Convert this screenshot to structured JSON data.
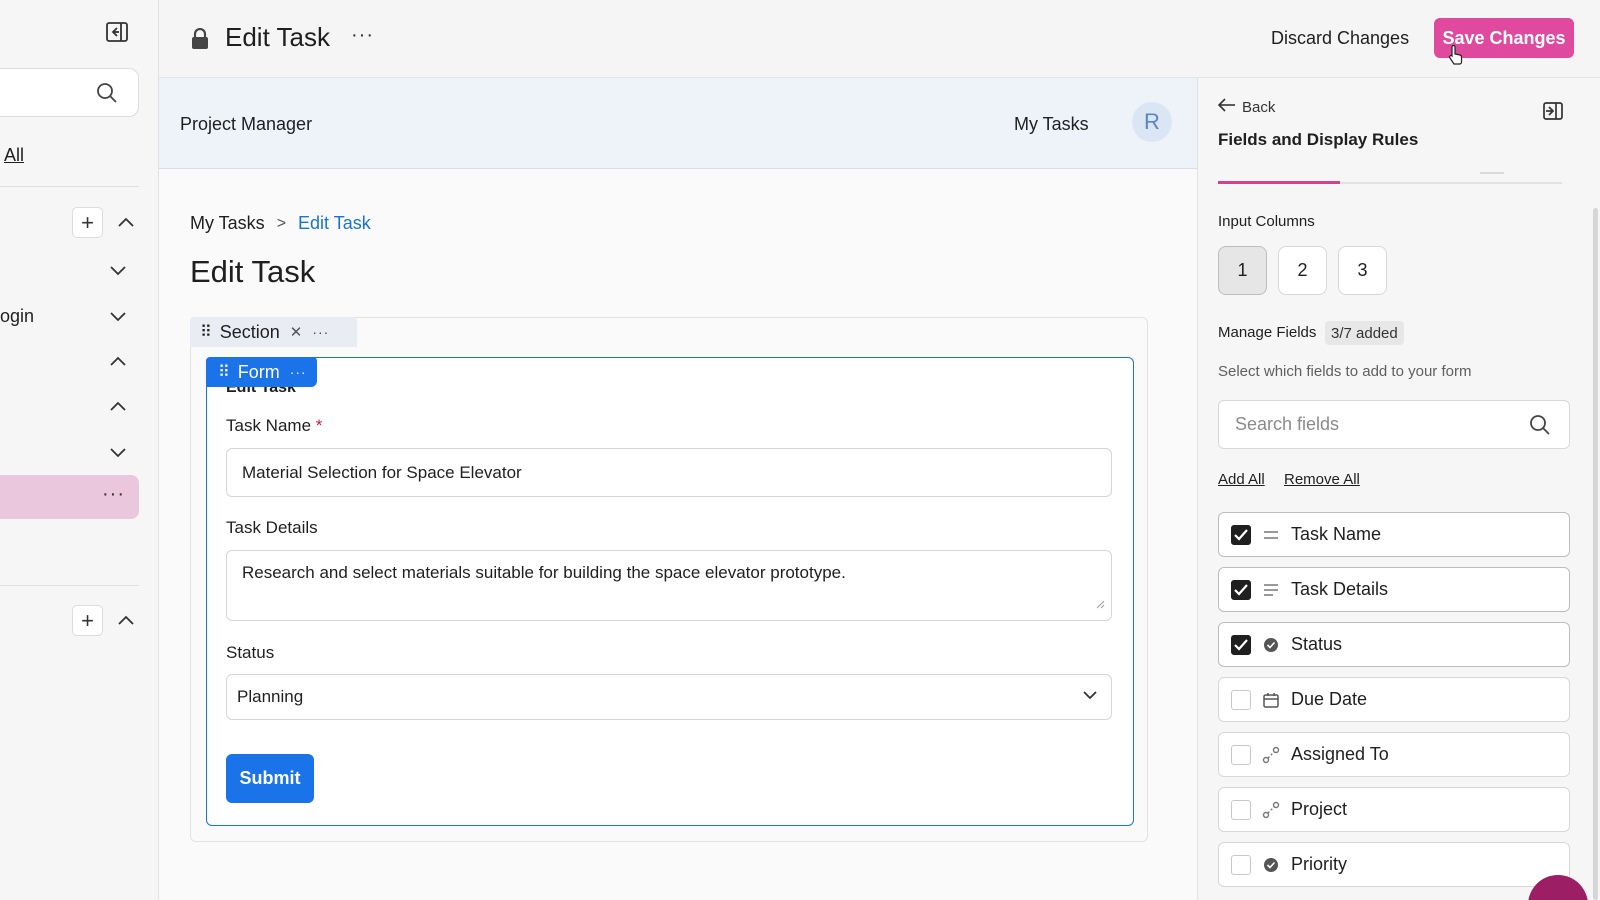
{
  "sidebar": {
    "all_label": "All",
    "login_label": "ogin",
    "active_more": "···"
  },
  "topbar": {
    "title": "Edit Task",
    "more": "···",
    "discard_label": "Discard Changes",
    "save_label": "Save Changes"
  },
  "app": {
    "title": "Project Manager",
    "nav_item": "My Tasks",
    "avatar_initial": "R"
  },
  "breadcrumb": {
    "home": "My Tasks",
    "separator": ">",
    "current": "Edit Task"
  },
  "page": {
    "title": "Edit Task"
  },
  "section": {
    "label": "Section",
    "more": "···"
  },
  "form": {
    "label": "Form",
    "more": "···",
    "subtitle": "Edit Task",
    "task_name_label": "Task Name",
    "required_mark": "*",
    "task_name_value": "Material Selection for Space Elevator",
    "task_details_label": "Task Details",
    "task_details_value": "Research and select materials suitable for building the space elevator prototype.",
    "status_label": "Status",
    "status_value": "Planning",
    "submit_label": "Submit"
  },
  "panel": {
    "back_label": "Back",
    "title": "Fields and Display Rules",
    "input_columns_label": "Input Columns",
    "columns": [
      "1",
      "2",
      "3"
    ],
    "selected_column": "1",
    "manage_fields_label": "Manage Fields",
    "added_badge": "3/7 added",
    "hint": "Select which fields to add to your form",
    "search_placeholder": "Search fields",
    "add_all": "Add All",
    "remove_all": "Remove All",
    "fields": [
      {
        "label": "Task Name",
        "checked": true,
        "icon": "text-lines-icon"
      },
      {
        "label": "Task Details",
        "checked": true,
        "icon": "paragraph-icon"
      },
      {
        "label": "Status",
        "checked": true,
        "icon": "status-check-icon"
      },
      {
        "label": "Due Date",
        "checked": false,
        "icon": "calendar-icon"
      },
      {
        "label": "Assigned To",
        "checked": false,
        "icon": "link-icon"
      },
      {
        "label": "Project",
        "checked": false,
        "icon": "link-icon"
      },
      {
        "label": "Priority",
        "checked": false,
        "icon": "status-check-icon"
      }
    ]
  },
  "colors": {
    "accent_pink": "#e04a9e",
    "primary_blue": "#1a73e8",
    "active_row": "#ebc7de"
  }
}
